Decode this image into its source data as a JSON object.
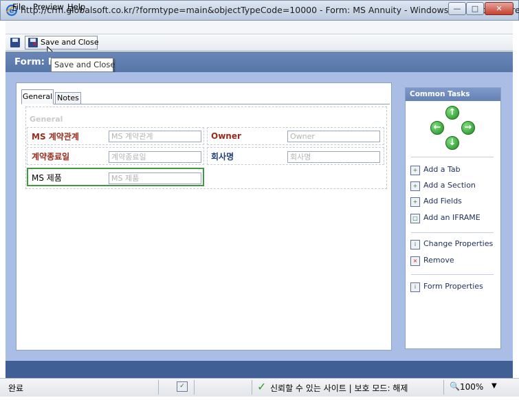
{
  "window": {
    "title": "http://crm.globalsoft.co.kr/?formtype=main&objectTypeCode=10000 - Form: MS Annuity - Windows Internet Explorer",
    "min_glyph": "—",
    "max_glyph": "□",
    "close_glyph": "✕"
  },
  "menubar": {
    "items": [
      {
        "accel": "F",
        "rest": "ile"
      },
      {
        "accel": "",
        "rest": "Preview"
      },
      {
        "accel": "H",
        "rest": "elp"
      }
    ]
  },
  "toolbar": {
    "save_close_label": "Save and Close"
  },
  "form_header": {
    "title": "Form: M"
  },
  "tooltip": {
    "text": "Save and Close"
  },
  "tabs": [
    {
      "label": "General",
      "active": true
    },
    {
      "label": "Notes",
      "active": false
    }
  ],
  "section": {
    "title": "General",
    "fields": [
      {
        "label": "MS 계약관계",
        "placeholder": "MS 계약관계",
        "style": "required"
      },
      {
        "label": "Owner",
        "placeholder": "Owner",
        "style": "required"
      },
      {
        "label": "계약종료일",
        "placeholder": "계약종료일",
        "style": "required"
      },
      {
        "label": "회사명",
        "placeholder": "회사명",
        "style": "recommended"
      },
      {
        "label": "MS 제품",
        "placeholder": "MS 제품",
        "style": "normal",
        "selected": true
      }
    ]
  },
  "common_tasks": {
    "header": "Common Tasks",
    "arrows": {
      "up": "↑",
      "left": "←",
      "right": "→",
      "down": "↓"
    },
    "groups": [
      [
        "Add a Tab",
        "Add a Section",
        "Add Fields",
        "Add an IFRAME"
      ],
      [
        "Change Properties",
        "Remove"
      ],
      [
        "Form Properties"
      ]
    ]
  },
  "statusbar": {
    "status": "완료",
    "trust_text": "신뢰할 수 있는 사이트 | 보호 모드: 해제",
    "zoom": "100%",
    "zoom_icon": "🔍",
    "dropdown_glyph": "▼"
  },
  "colors": {
    "required_label": "#9a2a1a",
    "recommended_label": "#1f3f7a",
    "header_blue": "#5675a8",
    "main_bg": "#a9bde5",
    "selected_field_border": "#3f9a3f"
  }
}
